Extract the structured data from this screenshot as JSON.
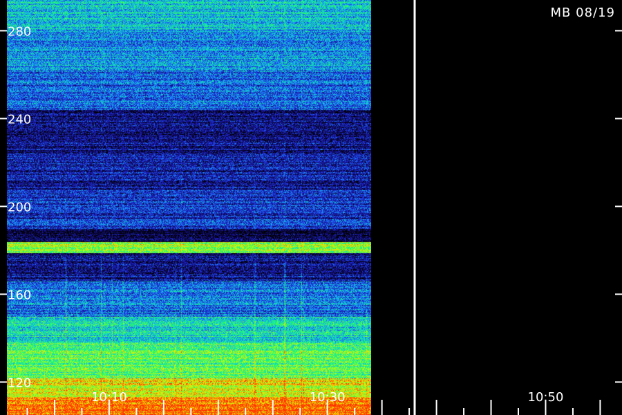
{
  "chart_data": {
    "type": "heatmap",
    "title": "MB 08/19",
    "xlabel": "",
    "ylabel": "",
    "x_tick_labels": [
      "10:10",
      "10:30",
      "10:50"
    ],
    "y_tick_labels": [
      "280",
      "240",
      "200",
      "160",
      "120"
    ],
    "y_ticks": [
      280,
      240,
      200,
      160,
      120
    ],
    "ylim": [
      105,
      294
    ],
    "x_time_range": [
      "10:00",
      "10:57"
    ],
    "data_end_time": "10:34",
    "gap_marker_time": "10:38",
    "colormap": [
      "#000000",
      "#140a7a",
      "#1f2ad8",
      "#1a8aff",
      "#10e0c0",
      "#20ff60",
      "#c0ff10",
      "#ffd000",
      "#ff3000"
    ],
    "bands": [
      {
        "y_from": 281,
        "y_to": 294,
        "level": 0.45
      },
      {
        "y_from": 262,
        "y_to": 281,
        "level": 0.38
      },
      {
        "y_from": 244,
        "y_to": 262,
        "level": 0.32
      },
      {
        "y_from": 223,
        "y_to": 244,
        "level": 0.14
      },
      {
        "y_from": 208,
        "y_to": 223,
        "level": 0.18
      },
      {
        "y_from": 190,
        "y_to": 208,
        "level": 0.24
      },
      {
        "y_from": 184,
        "y_to": 190,
        "level": 0.06
      },
      {
        "y_from": 179,
        "y_to": 184,
        "level": 0.72
      },
      {
        "y_from": 166,
        "y_to": 179,
        "level": 0.16
      },
      {
        "y_from": 150,
        "y_to": 166,
        "level": 0.34
      },
      {
        "y_from": 138,
        "y_to": 150,
        "level": 0.5
      },
      {
        "y_from": 122,
        "y_to": 138,
        "level": 0.64
      },
      {
        "y_from": 113,
        "y_to": 122,
        "level": 0.8
      },
      {
        "y_from": 105,
        "y_to": 113,
        "level": 0.95
      }
    ]
  }
}
